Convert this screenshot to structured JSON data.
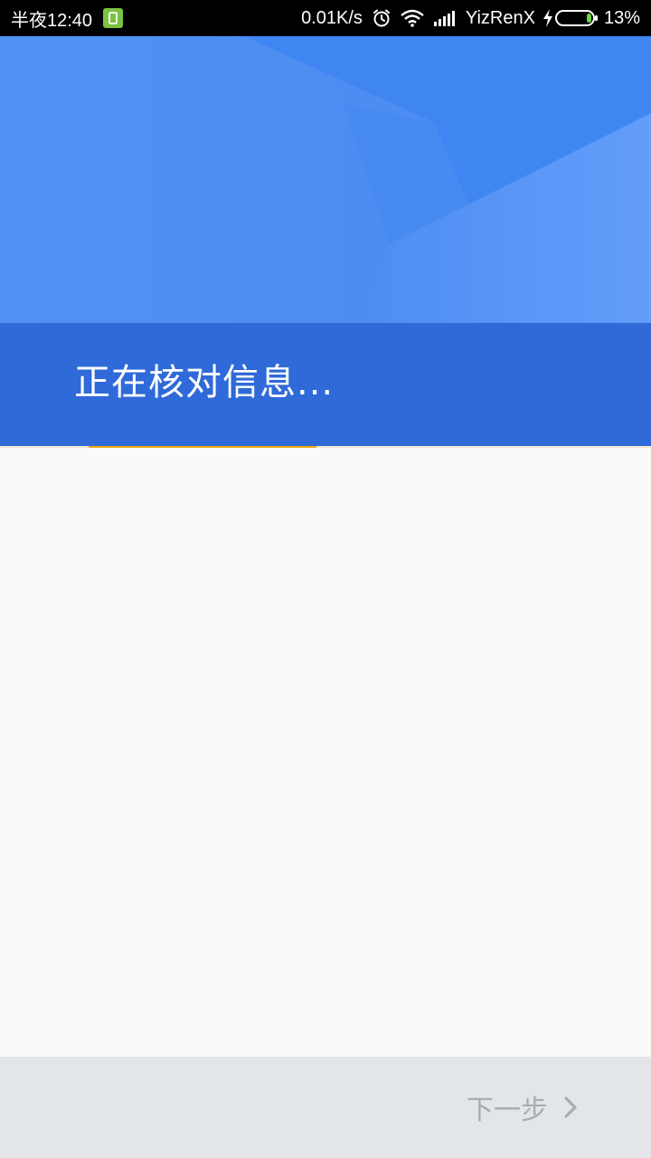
{
  "status_bar": {
    "time": "半夜12:40",
    "network_speed": "0.01K/s",
    "carrier": "YizRenX",
    "battery": "13%",
    "icons": [
      "app-notification-icon",
      "alarm-icon",
      "wifi-icon",
      "signal-icon",
      "charging-icon",
      "battery-icon"
    ]
  },
  "header": {
    "title": "正在核对信息...",
    "progress_fraction": 0.35
  },
  "footer": {
    "next_label": "下一步",
    "next_icon": "chevron-right-icon"
  },
  "colors": {
    "header_light": "#4f8ef2",
    "header_band": "#2f6ad8",
    "progress": "#f3a812",
    "content_bg": "#fafafa",
    "bottom_bar": "#e3e6e9",
    "next_text": "#a9adb2"
  }
}
